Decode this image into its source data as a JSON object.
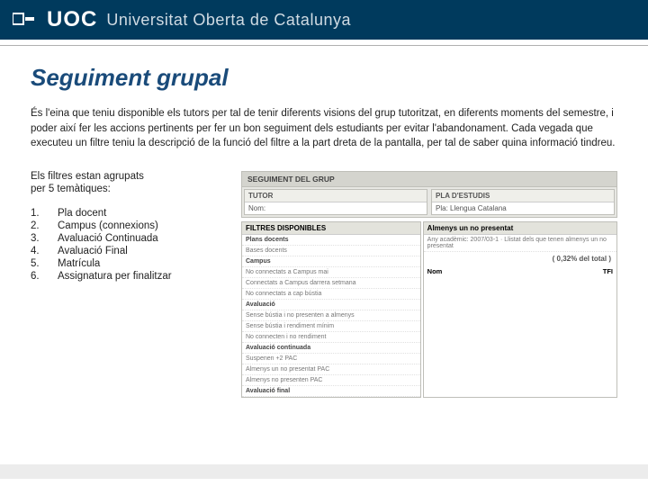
{
  "header": {
    "brand": "UOC",
    "university": "Universitat Oberta de Catalunya"
  },
  "title": "Seguiment grupal",
  "intro": "És l'eina que teniu disponible els tutors per tal de tenir diferents visions del grup tutoritzat, en diferents moments del semestre, i poder així fer les accions pertinents per fer un bon seguiment dels estudiants per evitar l'abandonament. Cada vegada que executeu un filtre teniu la descripció de la funció del filtre a la part dreta de la pantalla, per tal de saber quina informació tindreu.",
  "filters_caption1": "Els filtres estan agrupats",
  "filters_caption2": "per 5 temàtiques:",
  "filters": [
    {
      "n": "1.",
      "label": "Pla docent"
    },
    {
      "n": "2.",
      "label": "Campus (connexions)"
    },
    {
      "n": "3.",
      "label": "Avaluació Continuada"
    },
    {
      "n": "4.",
      "label": "Avaluació Final"
    },
    {
      "n": "5.",
      "label": "Matrícula"
    },
    {
      "n": "6.",
      "label": "Assignatura per finalitzar"
    }
  ],
  "panel": {
    "main_header": "SEGUIMENT DEL GRUP",
    "tutor_header": "TUTOR",
    "tutor_value": "Nom:",
    "pla_header": "PLA D'ESTUDIS",
    "pla_value": "Pla: Llengua Catalana",
    "filtres_header": "FILTRES DISPONIBLES",
    "any_header": "Almenys un no presentat",
    "any_value": "Any acadèmic: 2007/03-1 · Llistat dels que tenen almenys un no presentat",
    "pct": "( 0,32% del total )",
    "nom_col": "Nom",
    "tfi_col": "TFI",
    "items": {
      "i1": "Plans docents",
      "i2": "Bases docents",
      "i3": "Campus",
      "i4": "No connectats a Campus mai",
      "i5": "Connectats a Campus darrera setmana",
      "i6": "No connectats a cap bústia",
      "i7": "Avaluació",
      "i8": "Sense bústia i no presenten a almenys",
      "i9": "Sense bústia i rendiment mínim",
      "i10": "No connecten i no rendiment",
      "i11": "Avaluació continuada",
      "i12": "Suspenen +2 PAC",
      "i13": "Almenys un no presentat PAC",
      "i14": "Almenys no presenten PAC",
      "i15": "Avaluació final"
    }
  }
}
